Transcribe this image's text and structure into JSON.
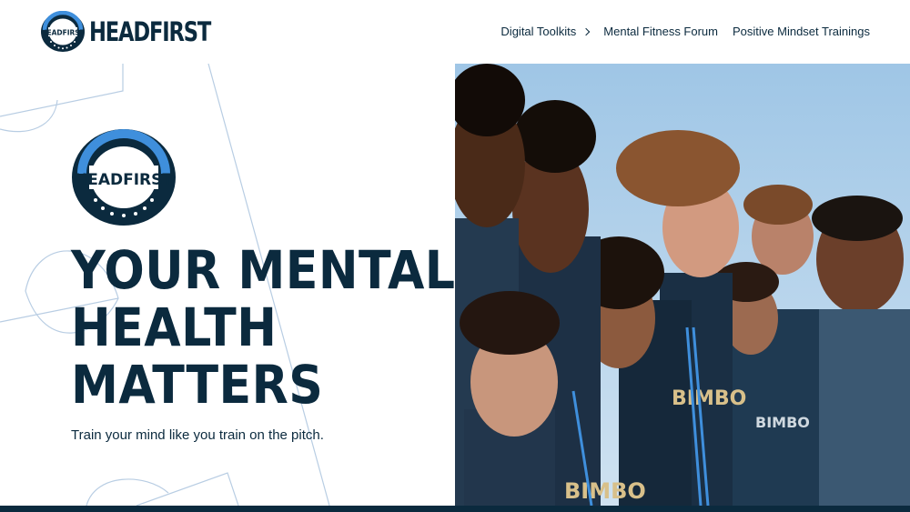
{
  "brand": {
    "name": "HeadFirst",
    "logo_text": "HEADFIRST",
    "badge_text": "HEADFIRST"
  },
  "nav": [
    {
      "label": "Digital Toolkits",
      "has_submenu": true
    },
    {
      "label": "Mental Fitness Forum",
      "has_submenu": false
    },
    {
      "label": "Positive Mindset Trainings",
      "has_submenu": false
    }
  ],
  "hero": {
    "headline_lines": [
      "YOUR MENTAL",
      "HEALTH",
      "MATTERS"
    ],
    "subheadline": "Train your mind like you train on the pitch.",
    "image_icon": "team-photo",
    "jersey_text": "BIMBO"
  },
  "colors": {
    "navy": "#0b2a3e",
    "accent_blue": "#3f8fdc",
    "sky": "#b9d6ec",
    "line": "#b8cde3"
  }
}
